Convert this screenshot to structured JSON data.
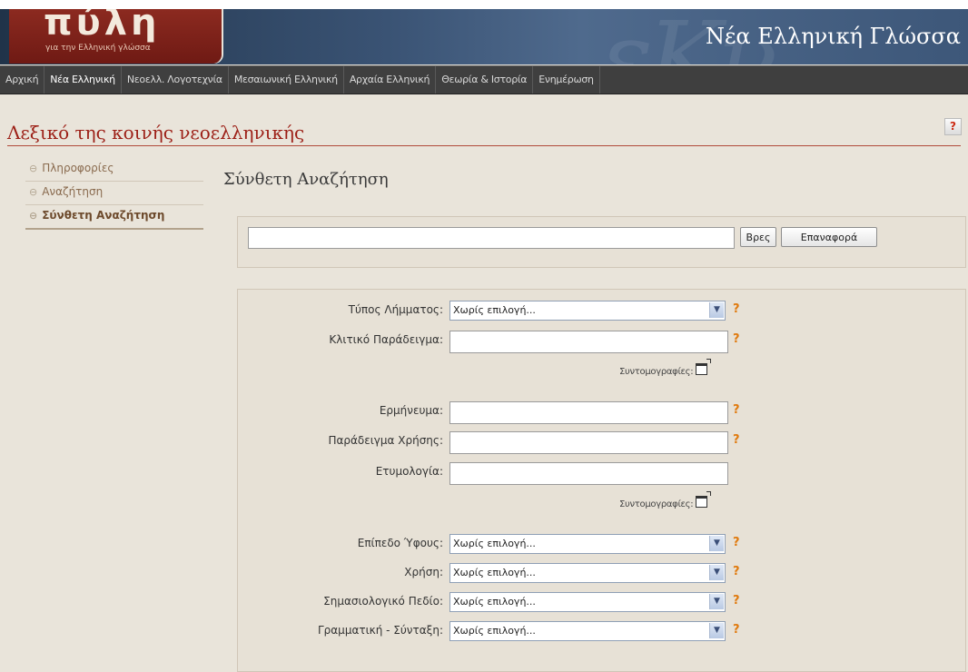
{
  "header": {
    "logo_word": "πύλη",
    "logo_tagline": "για την Ελληνική γλώσσα",
    "site_title": "Νέα Ελληνική Γλώσσα"
  },
  "nav": {
    "items": [
      {
        "label": "Αρχική"
      },
      {
        "label": "Νέα Ελληνική"
      },
      {
        "label": "Νεοελλ. Λογοτεχνία"
      },
      {
        "label": "Μεσαιωνική Ελληνική"
      },
      {
        "label": "Αρχαία Ελληνική"
      },
      {
        "label": "Θεωρία & Ιστορία"
      },
      {
        "label": "Ενημέρωση"
      }
    ]
  },
  "dictionary": {
    "title": "Λεξικό της κοινής νεοελληνικής",
    "help_label": "?"
  },
  "sidebar": {
    "items": [
      {
        "label": "Πληροφορίες"
      },
      {
        "label": "Αναζήτηση"
      },
      {
        "label": "Σύνθετη Αναζήτηση"
      }
    ]
  },
  "main": {
    "title": "Σύνθετη Αναζήτηση",
    "search": {
      "value": "",
      "find_button": "Βρες",
      "reset_button": "Επαναφορά"
    },
    "form": {
      "lemma_type": {
        "label": "Τύπος Λήμματος:",
        "value": "Χωρίς επιλογή..."
      },
      "inflection_example": {
        "label": "Κλιτικό Παράδειγμα:",
        "value": ""
      },
      "abbreviations_label": "Συντομογραφίες:",
      "definition": {
        "label": "Ερμήνευμα:",
        "value": ""
      },
      "usage_example": {
        "label": "Παράδειγμα Χρήσης:",
        "value": ""
      },
      "etymology": {
        "label": "Ετυμολογία:",
        "value": ""
      },
      "style_level": {
        "label": "Επίπεδο Ύφους:",
        "value": "Χωρίς επιλογή..."
      },
      "usage": {
        "label": "Χρήση:",
        "value": "Χωρίς επιλογή..."
      },
      "semantic_field": {
        "label": "Σημασιολογικό Πεδίο:",
        "value": "Χωρίς επιλογή..."
      },
      "grammar_syntax": {
        "label": "Γραμματική - Σύνταξη:",
        "value": "Χωρίς επιλογή..."
      },
      "help_label": "?",
      "dropdown_arrow": "▼"
    }
  },
  "colors": {
    "accent_red": "#9c1f16",
    "help_orange": "#e07a0e",
    "nav_bg": "#3f3f3f",
    "header_bg": "#3a5374",
    "page_bg": "#e9e4da"
  },
  "icons": {
    "sidebar_bullet": "⊖",
    "abbreviation_window": "window-icon"
  }
}
